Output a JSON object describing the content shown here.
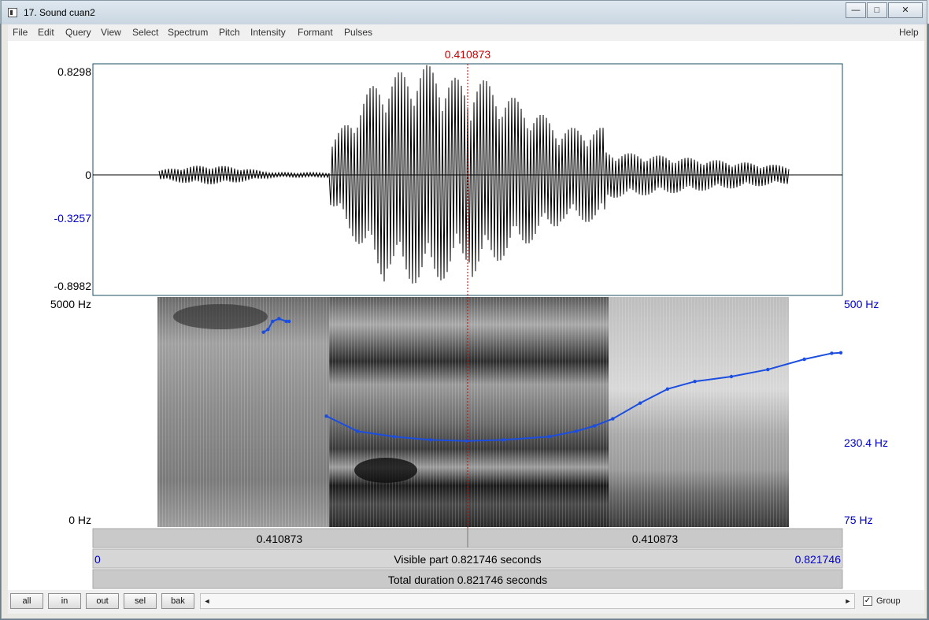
{
  "window": {
    "title": "17. Sound cuan2",
    "controls": {
      "minimize": "—",
      "maximize": "□",
      "close": "✕"
    }
  },
  "menu": [
    "File",
    "Edit",
    "Query",
    "View",
    "Select",
    "Spectrum",
    "Pitch",
    "Intensity",
    "Formant",
    "Pulses"
  ],
  "help": "Help",
  "cursor_time": "0.410873",
  "waveform": {
    "y_max": "0.8298",
    "y_zero": "0",
    "y_cursor": "-0.3257",
    "y_min": "-0.8982"
  },
  "spectrogram": {
    "freq_max": "5000 Hz",
    "freq_min": "0 Hz",
    "pitch_max": "500 Hz",
    "pitch_value": "230.4 Hz",
    "pitch_min": "75 Hz"
  },
  "time_bar": {
    "left_segment": "0.410873",
    "right_segment": "0.410873"
  },
  "visible": {
    "start": "0",
    "label": "Visible part 0.821746 seconds",
    "end": "0.821746"
  },
  "total": "Total duration 0.821746 seconds",
  "buttons": {
    "all": "all",
    "in": "in",
    "out": "out",
    "sel": "sel",
    "bak": "bak"
  },
  "scroll_arrows": {
    "left": "◄",
    "right": "►"
  },
  "group": {
    "label": "Group",
    "checked": true,
    "mark": "✓"
  },
  "colors": {
    "cursor": "#cc0000",
    "axis_blue": "#0000cc",
    "pitch": "#1b4ee0"
  },
  "chart_data": {
    "type": "line",
    "x_unit": "s",
    "y_unit": "Hz",
    "ylim": [
      75,
      500
    ],
    "xlim": [
      0,
      0.821746
    ],
    "series": [
      {
        "x": [
          0.187,
          0.192,
          0.197,
          0.204,
          0.212,
          0.215
        ],
        "y": [
          435,
          440,
          455,
          460,
          455,
          455
        ]
      },
      {
        "x": [
          0.256,
          0.29,
          0.33,
          0.37,
          0.41,
          0.45,
          0.5,
          0.53,
          0.55,
          0.57,
          0.6,
          0.63,
          0.66,
          0.7,
          0.74,
          0.78,
          0.81,
          0.82
        ],
        "y": [
          280,
          252,
          242,
          236,
          234,
          236,
          242,
          252,
          262,
          275,
          304,
          330,
          344,
          353,
          366,
          385,
          396,
          397
        ]
      }
    ]
  }
}
